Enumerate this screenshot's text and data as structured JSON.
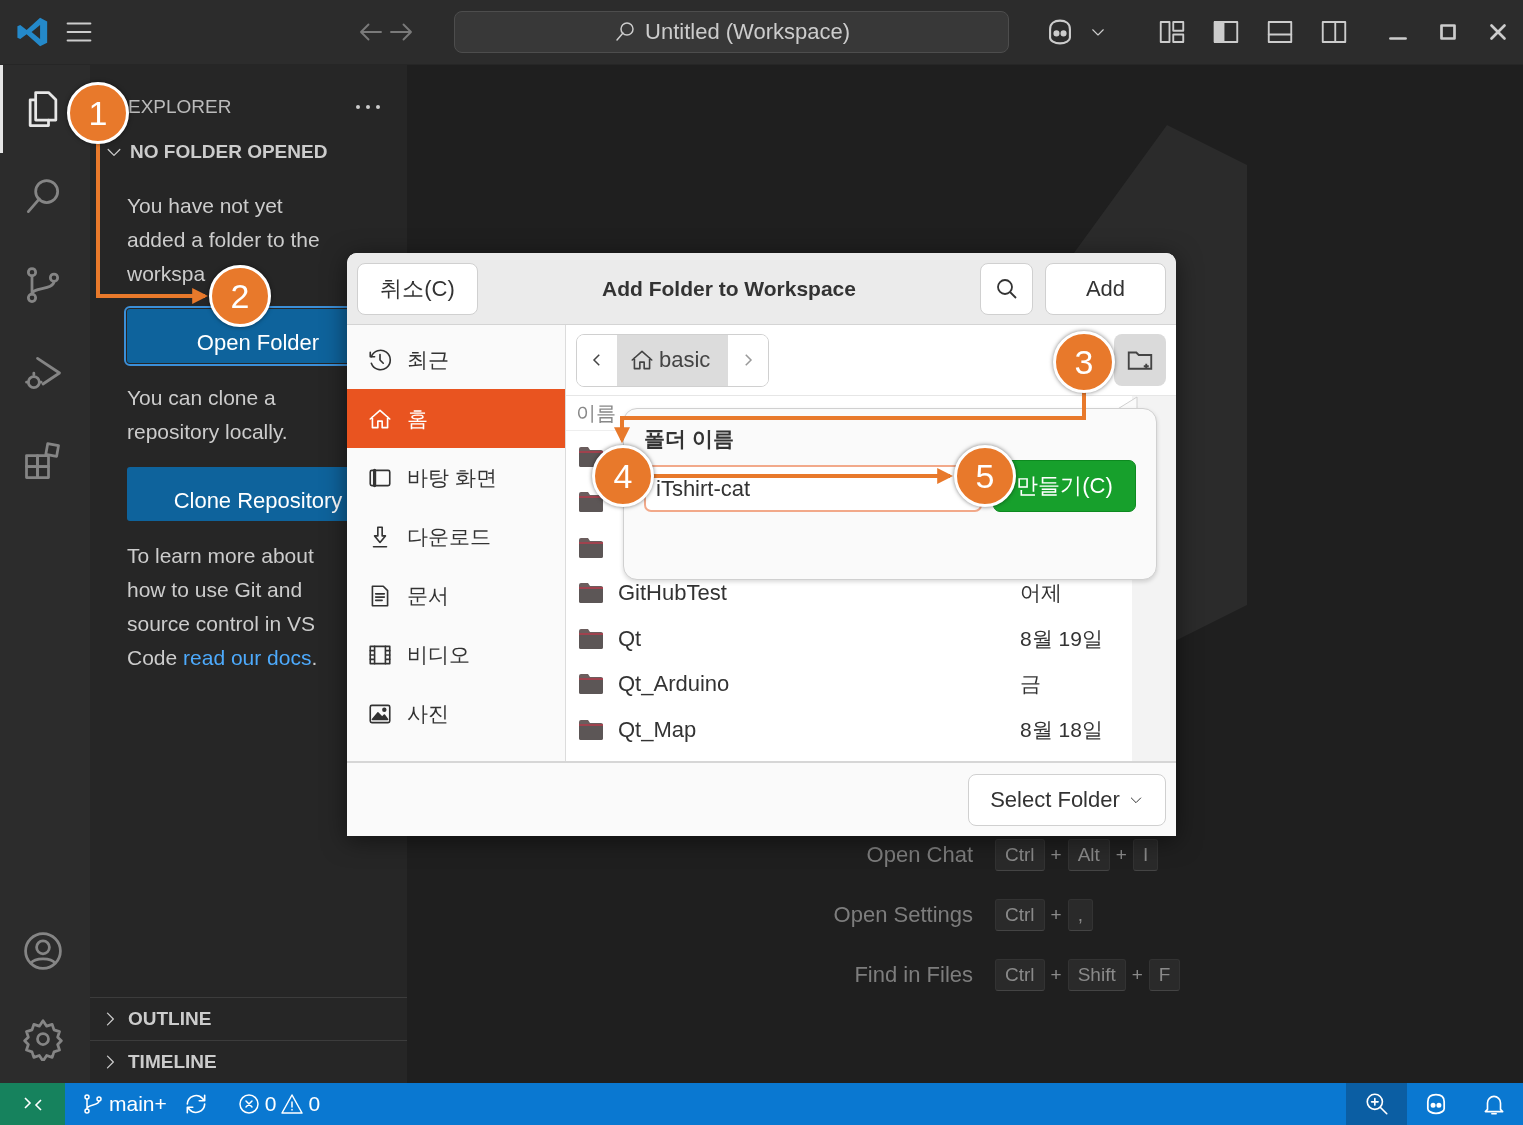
{
  "title_bar": {
    "search": "Untitled (Workspace)"
  },
  "activity_bar": {
    "items": [
      {
        "kind": "explorer",
        "selected": true
      },
      {
        "kind": "search",
        "selected": false
      },
      {
        "kind": "source-control",
        "selected": false
      },
      {
        "kind": "run",
        "selected": false
      },
      {
        "kind": "extensions",
        "selected": false
      }
    ],
    "bottom": [
      {
        "kind": "account"
      },
      {
        "kind": "settings"
      }
    ]
  },
  "sidebar": {
    "title": "EXPLORER",
    "section": {
      "title": "NO FOLDER OPENED",
      "expanded": true
    },
    "content": [
      {
        "kind": "text",
        "text": "You have not yet added a folder to the workspa"
      },
      {
        "kind": "button",
        "label": "Open Folder",
        "focused": true
      },
      {
        "kind": "text",
        "text": "You can clone a repository locally."
      },
      {
        "kind": "button",
        "label": "Clone Repository",
        "focused": false
      },
      {
        "kind": "text",
        "text": "To learn more about how to use Git and source control in VS Code ",
        "link": "read our docs",
        "after": "."
      }
    ],
    "panels": [
      {
        "title": "OUTLINE",
        "expanded": false
      },
      {
        "title": "TIMELINE",
        "expanded": false
      }
    ]
  },
  "shortcuts": [
    {
      "label": "Open Chat",
      "parts": [
        {
          "kind": "key",
          "text": "Ctrl"
        },
        {
          "kind": "plus",
          "text": "+"
        },
        {
          "kind": "key",
          "text": "Alt"
        },
        {
          "kind": "plus",
          "text": "+"
        },
        {
          "kind": "key",
          "text": "I"
        }
      ]
    },
    {
      "label": "Open Settings",
      "parts": [
        {
          "kind": "key",
          "text": "Ctrl"
        },
        {
          "kind": "plus",
          "text": "+"
        },
        {
          "kind": "key",
          "text": ","
        }
      ]
    },
    {
      "label": "Find in Files",
      "parts": [
        {
          "kind": "key",
          "text": "Ctrl"
        },
        {
          "kind": "plus",
          "text": "+"
        },
        {
          "kind": "key",
          "text": "Shift"
        },
        {
          "kind": "plus",
          "text": "+"
        },
        {
          "kind": "key",
          "text": "F"
        }
      ]
    }
  ],
  "dialog": {
    "cancel": "취소(C)",
    "title": "Add Folder to Workspace",
    "confirm": "Add",
    "places": [
      {
        "kind": "recent",
        "label": "최근",
        "selected": false
      },
      {
        "kind": "home",
        "label": "홈",
        "selected": true
      },
      {
        "kind": "desktop",
        "label": "바탕 화면",
        "selected": false
      },
      {
        "kind": "downloads",
        "label": "다운로드",
        "selected": false
      },
      {
        "kind": "documents",
        "label": "문서",
        "selected": false
      },
      {
        "kind": "videos",
        "label": "비디오",
        "selected": false
      },
      {
        "kind": "pictures",
        "label": "사진",
        "selected": false
      }
    ],
    "path": "basic",
    "column_header": "이름",
    "files": [
      {
        "kind": "folder"
      },
      {
        "kind": "folder"
      },
      {
        "kind": "folder"
      },
      {
        "kind": "folder",
        "name": "GitHubTest",
        "modified": "어제"
      },
      {
        "kind": "folder",
        "name": "Qt",
        "modified": "8월 19일"
      },
      {
        "kind": "folder",
        "name": "Qt_Arduino",
        "modified": "금"
      },
      {
        "kind": "folder",
        "name": "Qt_Map",
        "modified": "8월 18일"
      }
    ],
    "filter": "Select Folder",
    "new_folder": {
      "label": "폴더 이름",
      "value": "iTshirt-cat",
      "create": "만들기(C)"
    }
  },
  "annotations": [
    {
      "number": "1"
    },
    {
      "number": "2"
    },
    {
      "number": "3"
    },
    {
      "number": "4"
    },
    {
      "number": "5"
    }
  ],
  "status_bar": {
    "branch": "main+",
    "errors": "0",
    "warnings": "0"
  }
}
